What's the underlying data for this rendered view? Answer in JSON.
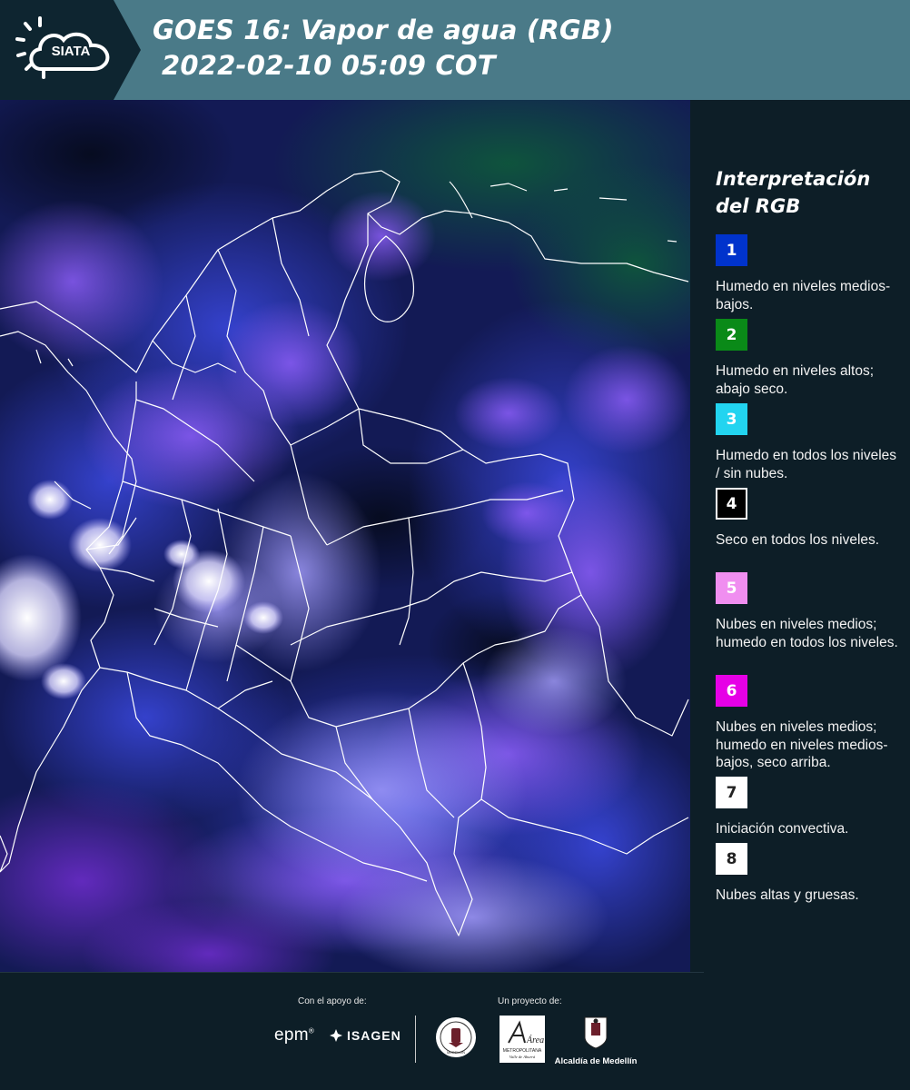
{
  "header": {
    "logo_text": "SIATA",
    "title_line1": "GOES 16: Vapor de agua (RGB)",
    "title_line2": "2022-02-10 05:09 COT"
  },
  "map": {
    "image_description_icon": "satellite-water-vapor-map",
    "border_color": "#ffffff"
  },
  "legend": {
    "title": "Interpretación del RGB",
    "items": [
      {
        "number": "1",
        "color": "#0033cc",
        "text": "Humedo en niveles medios-bajos."
      },
      {
        "number": "2",
        "color": "#0a8a18",
        "text": "Humedo en niveles altos; abajo seco."
      },
      {
        "number": "3",
        "color": "#22d4f0",
        "text": "Humedo en todos los niveles / sin nubes."
      },
      {
        "number": "4",
        "color": "#000000",
        "text": "Seco en todos los niveles."
      },
      {
        "number": "5",
        "color": "#f08ef0",
        "text": "Nubes en niveles medios; humedo en todos los niveles."
      },
      {
        "number": "6",
        "color": "#e600e6",
        "text": "Nubes en niveles medios; humedo en niveles medios-bajos, seco arriba."
      },
      {
        "number": "7",
        "color": "#ffffff",
        "text": "Iniciación convectiva."
      },
      {
        "number": "8",
        "color": "#ffffff",
        "text": "Nubes altas y gruesas."
      }
    ]
  },
  "footer": {
    "support_label": "Con el apoyo de:",
    "project_label": "Un proyecto de:",
    "epm": "epm",
    "isagen": "ISAGEN",
    "alcaldia": "Alcaldía de Medellín",
    "seal_text": "MEDELLÍN",
    "area_script": "Área",
    "area_sub1": "METROPOLITANA",
    "area_sub2": "Valle de Aburrá"
  }
}
